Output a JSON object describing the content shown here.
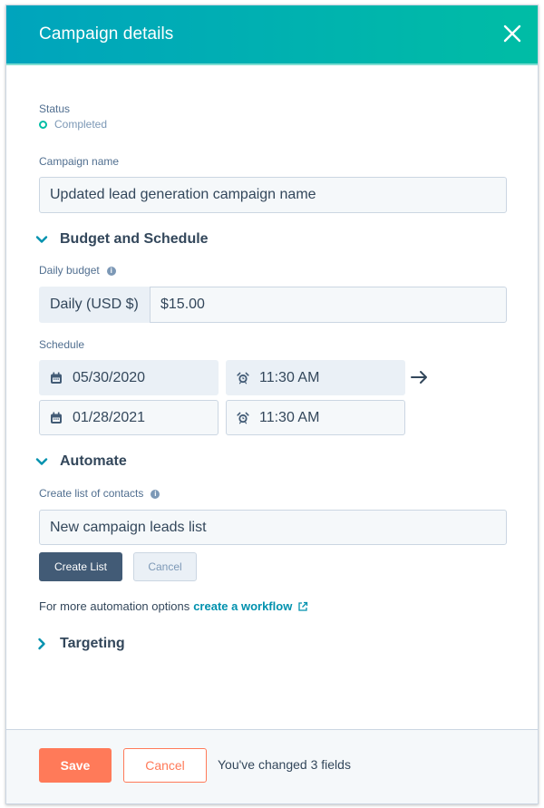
{
  "header": {
    "title": "Campaign details",
    "close_icon": "close-icon"
  },
  "status": {
    "label": "Status",
    "value": "Completed",
    "color": "#00bda5"
  },
  "campaign_name": {
    "label": "Campaign name",
    "value": "Updated lead generation campaign name"
  },
  "budget_schedule": {
    "heading": "Budget and Schedule",
    "expanded": true,
    "daily_budget": {
      "label": "Daily budget",
      "addon": "Daily (USD $)",
      "value": "$15.00"
    },
    "schedule": {
      "label": "Schedule",
      "start": {
        "date": "05/30/2020",
        "time": "11:30 AM"
      },
      "end": {
        "date": "01/28/2021",
        "time": "11:30 AM"
      }
    }
  },
  "automate": {
    "heading": "Automate",
    "expanded": true,
    "list_label": "Create list of contacts",
    "list_value": "New campaign leads list",
    "create_button": "Create List",
    "cancel_button": "Cancel",
    "more_text": "For more automation options",
    "workflow_link": "create a workflow"
  },
  "targeting": {
    "heading": "Targeting",
    "expanded": false
  },
  "footer": {
    "save_label": "Save",
    "cancel_label": "Cancel",
    "changed_text": "You've changed 3 fields"
  },
  "colors": {
    "header_start": "#00a4bd",
    "header_end": "#00bda5",
    "accent": "#ff7a59",
    "link": "#0091ae",
    "dark_button": "#425b76"
  }
}
